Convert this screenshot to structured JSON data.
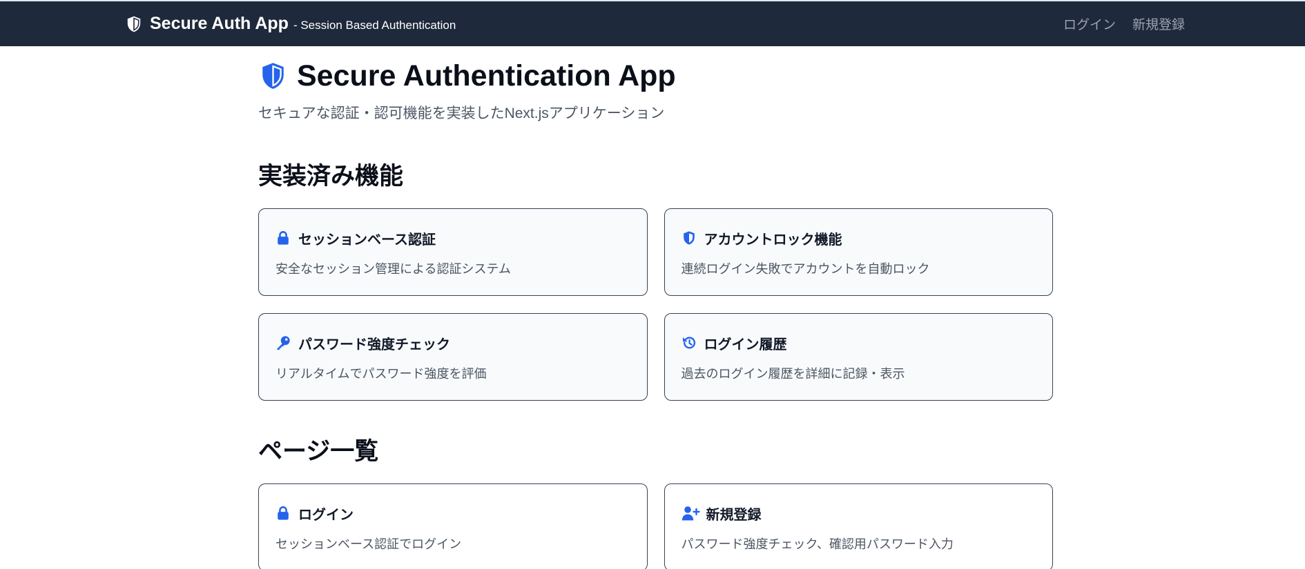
{
  "navbar": {
    "brand": "Secure Auth App",
    "brand_subtitle": "- Session Based Authentication",
    "links": [
      {
        "label": "ログイン"
      },
      {
        "label": "新規登録"
      }
    ]
  },
  "hero": {
    "icon": "shield-halved-icon",
    "title": "Secure Authentication App",
    "subtitle": "セキュアな認証・認可機能を実装したNext.jsアプリケーション"
  },
  "features": {
    "heading": "実装済み機能",
    "items": [
      {
        "icon": "lock-icon",
        "title": "セッションベース認証",
        "description": "安全なセッション管理による認証システム"
      },
      {
        "icon": "shield-halved-icon",
        "title": "アカウントロック機能",
        "description": "連続ログイン失敗でアカウントを自動ロック"
      },
      {
        "icon": "key-icon",
        "title": "パスワード強度チェック",
        "description": "リアルタイムでパスワード強度を評価"
      },
      {
        "icon": "history-icon",
        "title": "ログイン履歴",
        "description": "過去のログイン履歴を詳細に記録・表示"
      }
    ]
  },
  "pages": {
    "heading": "ページ一覧",
    "items": [
      {
        "icon": "lock-icon",
        "title": "ログイン",
        "description": "セッションベース認証でログイン"
      },
      {
        "icon": "user-plus-icon",
        "title": "新規登録",
        "description": "パスワード強度チェック、確認用パスワード入力"
      }
    ]
  },
  "colors": {
    "navbar_bg": "#1e293b",
    "accent": "#2563eb",
    "nav_link": "#9ca3af",
    "card_bg": "#f8fafc",
    "text_muted": "#4b5563"
  }
}
